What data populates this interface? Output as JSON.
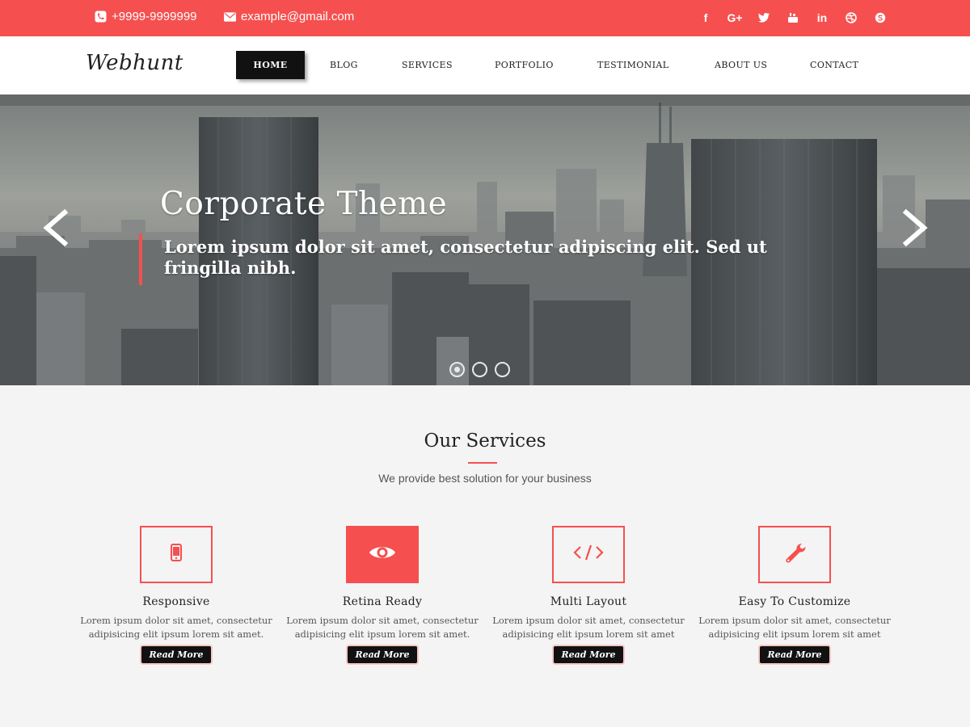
{
  "topbar": {
    "phone": "+9999-9999999",
    "email": "example@gmail.com",
    "phone_icon": "phone-icon",
    "email_icon": "envelope-icon",
    "socials": [
      {
        "name": "facebook-icon",
        "glyph": "f"
      },
      {
        "name": "google-plus-icon",
        "glyph": "G+"
      },
      {
        "name": "twitter-icon",
        "glyph": "t"
      },
      {
        "name": "youtube-icon",
        "glyph": "▶"
      },
      {
        "name": "linkedin-icon",
        "glyph": "in"
      },
      {
        "name": "dribbble-icon",
        "glyph": "◎"
      },
      {
        "name": "skype-icon",
        "glyph": "S"
      }
    ]
  },
  "header": {
    "logo": "Webhunt",
    "nav": [
      "HOME",
      "BLOG",
      "SERVICES",
      "PORTFOLIO",
      "TESTIMONIAL",
      "ABOUT US",
      "CONTACT"
    ],
    "active": "HOME"
  },
  "hero": {
    "title": "Corporate Theme",
    "subtitle": "Lorem ipsum dolor sit amet, consectetur adipiscing elit. Sed ut fringilla nibh.",
    "slide_count": 3,
    "active_slide": 1,
    "prev_icon": "chevron-left-icon",
    "next_icon": "chevron-right-icon"
  },
  "services": {
    "title": "Our Services",
    "subtitle": "We provide best solution for your business",
    "items": [
      {
        "icon": "mobile-icon",
        "title": "Responsive",
        "desc": "Lorem ipsum dolor sit amet, consectetur adipisicing elit ipsum lorem sit amet.",
        "button": "Read More"
      },
      {
        "icon": "eye-icon",
        "title": "Retina Ready",
        "desc": "Lorem ipsum dolor sit amet, consectetur adipisicing elit ipsum lorem sit amet.",
        "button": "Read More"
      },
      {
        "icon": "code-icon",
        "title": "Multi Layout",
        "desc": "Lorem ipsum dolor sit amet, consectetur adipisicing elit ipsum lorem sit amet",
        "button": "Read More"
      },
      {
        "icon": "wrench-icon",
        "title": "Easy To Customize",
        "desc": "Lorem ipsum dolor sit amet, consectetur adipisicing elit ipsum lorem sit amet",
        "button": "Read More"
      }
    ]
  },
  "colors": {
    "accent": "#f5504f",
    "dark": "#111111",
    "background": "#f4f4f4"
  }
}
